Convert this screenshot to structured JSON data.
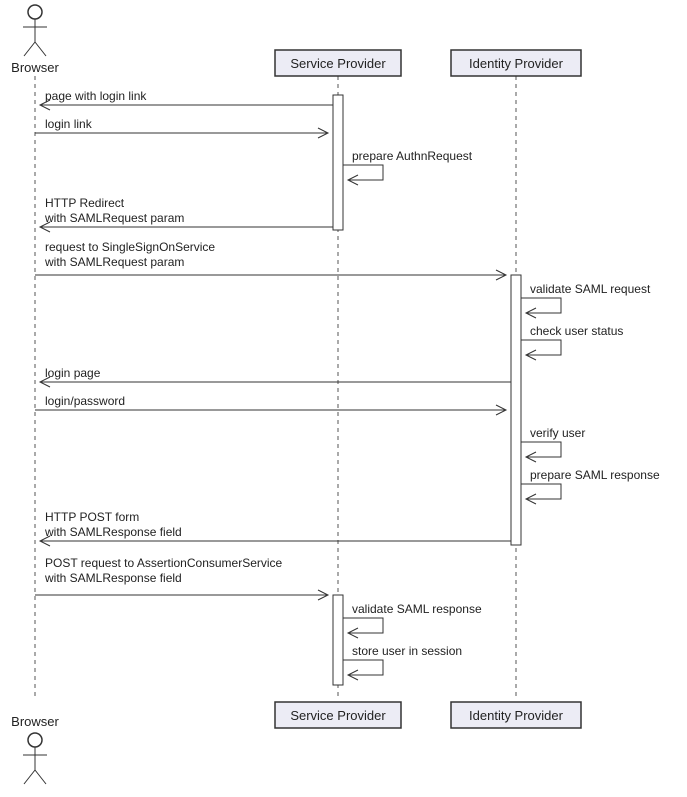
{
  "participants": {
    "browser": {
      "label": "Browser"
    },
    "sp": {
      "label": "Service Provider"
    },
    "idp": {
      "label": "Identity Provider"
    }
  },
  "messages": {
    "m1": "page with login link",
    "m2": "login link",
    "m3": "prepare AuthnRequest",
    "m4a": "HTTP Redirect",
    "m4b": "with SAMLRequest param",
    "m5a": "request to SingleSignOnService",
    "m5b": "with SAMLRequest param",
    "m6": "validate SAML request",
    "m7": "check user status",
    "m8": "login page",
    "m9": "login/password",
    "m10": "verify user",
    "m11": "prepare SAML response",
    "m12a": "HTTP POST form",
    "m12b": "with SAMLResponse field",
    "m13a": "POST request to AssertionConsumerService",
    "m13b": "with SAMLResponse field",
    "m14": "validate SAML response",
    "m15": "store user in session"
  }
}
